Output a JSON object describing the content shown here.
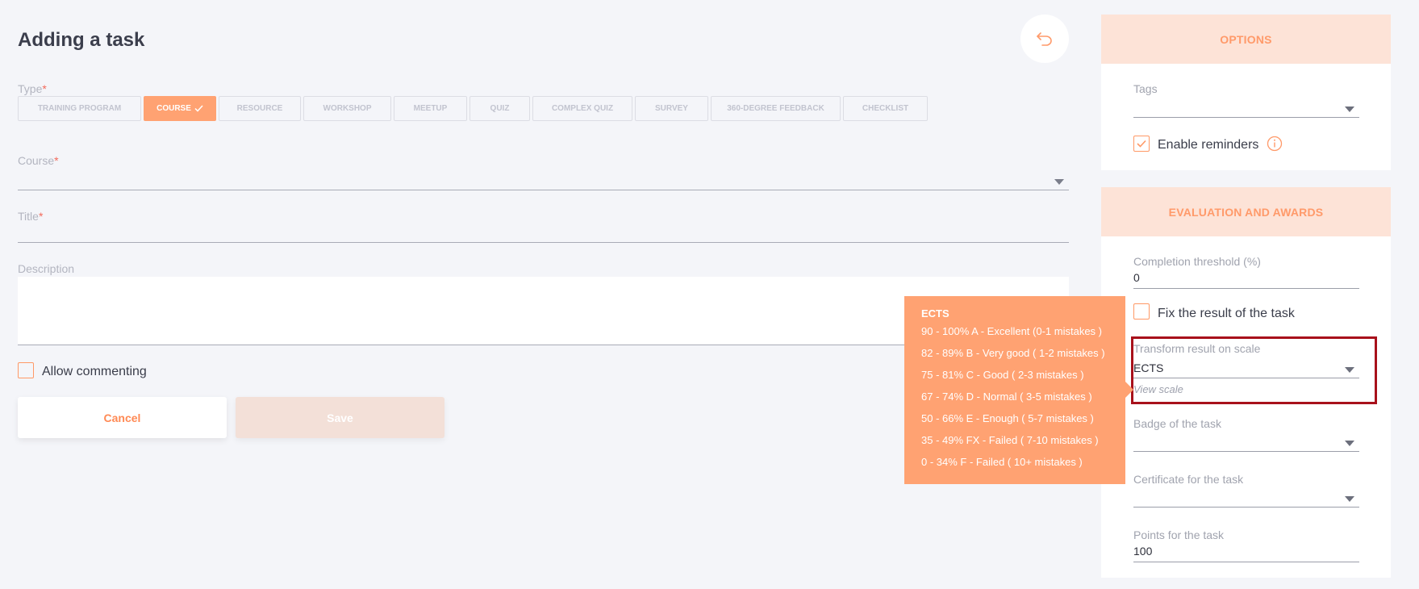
{
  "page": {
    "title": "Adding a task"
  },
  "colors": {
    "accent": "#ffa272",
    "panel_header_bg": "#fde3d7",
    "highlight": "#a8111b",
    "required": "#f36b5c"
  },
  "type": {
    "label": "Type",
    "tabs": [
      {
        "label": "TRAINING PROGRAM",
        "active": false
      },
      {
        "label": "COURSE",
        "active": true
      },
      {
        "label": "RESOURCE",
        "active": false
      },
      {
        "label": "WORKSHOP",
        "active": false
      },
      {
        "label": "MEETUP",
        "active": false
      },
      {
        "label": "QUIZ",
        "active": false
      },
      {
        "label": "COMPLEX QUIZ",
        "active": false
      },
      {
        "label": "SURVEY",
        "active": false
      },
      {
        "label": "360-DEGREE FEEDBACK",
        "active": false
      },
      {
        "label": "CHECKLIST",
        "active": false
      }
    ]
  },
  "form": {
    "course_label": "Course",
    "course_value": "",
    "title_label": "Title",
    "title_value": "",
    "description_label": "Description",
    "description_value": "",
    "allow_commenting_label": "Allow commenting",
    "allow_commenting_checked": false
  },
  "actions": {
    "cancel_label": "Cancel",
    "save_label": "Save"
  },
  "options": {
    "header": "OPTIONS",
    "tags_label": "Tags",
    "tags_value": "",
    "enable_reminders_label": "Enable reminders",
    "enable_reminders_checked": true
  },
  "evaluation": {
    "header": "EVALUATION AND AWARDS",
    "threshold_label": "Completion threshold (%)",
    "threshold_value": "0",
    "fix_result_label": "Fix the result of the task",
    "fix_result_checked": false,
    "scale_label": "Transform result on scale",
    "scale_value": "ECTS",
    "view_scale_label": "View scale",
    "badge_label": "Badge of the task",
    "badge_value": "",
    "certificate_label": "Certificate for the task",
    "certificate_value": "",
    "points_label": "Points for the task",
    "points_value": "100"
  },
  "scale_tooltip": {
    "title": "ECTS",
    "rows": [
      "90 - 100% A - Excellent (0-1 mistakes )",
      "82 - 89% B - Very good ( 1-2 mistakes )",
      "75 - 81% C - Good ( 2-3 mistakes )",
      "67 - 74% D - Normal ( 3-5 mistakes )",
      "50 - 66% E - Enough ( 5-7 mistakes )",
      "35 - 49% FX - Failed ( 7-10 mistakes )",
      "0 - 34% F - Failed ( 10+ mistakes )"
    ]
  }
}
